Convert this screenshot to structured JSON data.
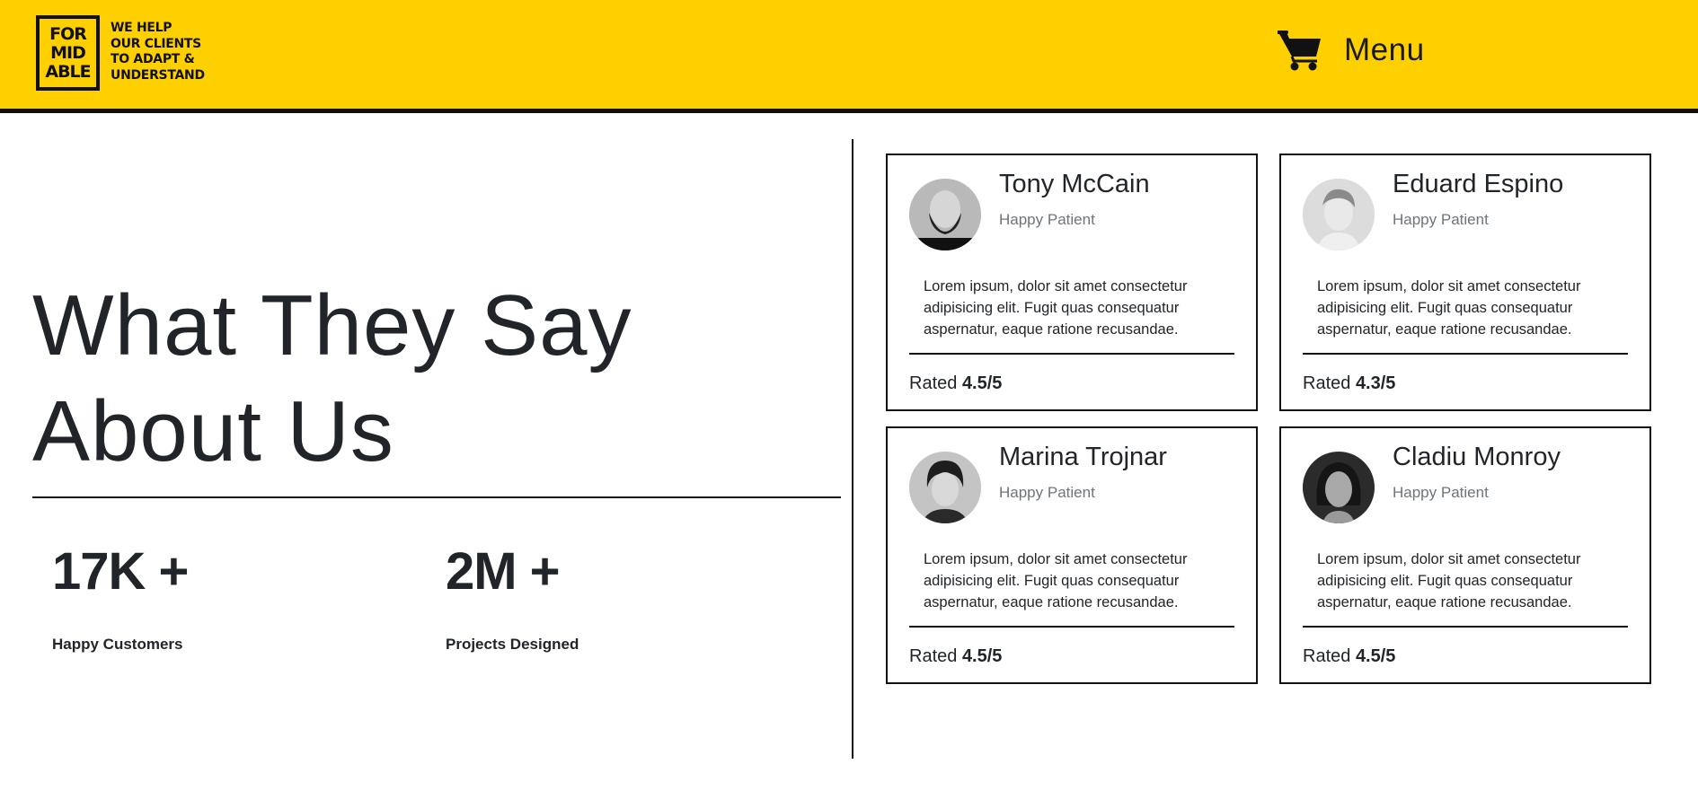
{
  "header": {
    "logo_lines": [
      "FOR",
      "MID",
      "ABLE"
    ],
    "tagline": [
      "WE HELP",
      "OUR CLIENTS",
      "TO ADAPT &",
      "UNDERSTAND"
    ],
    "cart_icon": "shopping-cart-icon",
    "menu_label": "Menu",
    "background_color": "#ffd000"
  },
  "main": {
    "heading_line1": "What They Say",
    "heading_line2": "About Us",
    "stats": [
      {
        "value": "17K +",
        "label": "Happy Customers"
      },
      {
        "value": "2M +",
        "label": "Projects Designed"
      }
    ]
  },
  "testimonials": [
    {
      "name": "Tony McCain",
      "role": "Happy Patient",
      "text": "Lorem ipsum, dolor sit amet consectetur adipisicing elit. Fugit quas consequatur aspernatur, eaque ratione recusandae.",
      "rating_prefix": "Rated",
      "rating": "4.5/5"
    },
    {
      "name": "Eduard Espino",
      "role": "Happy Patient",
      "text": "Lorem ipsum, dolor sit amet consectetur adipisicing elit. Fugit quas consequatur aspernatur, eaque ratione recusandae.",
      "rating_prefix": "Rated",
      "rating": "4.3/5"
    },
    {
      "name": "Marina Trojnar",
      "role": "Happy Patient",
      "text": "Lorem ipsum, dolor sit amet consectetur adipisicing elit. Fugit quas consequatur aspernatur, eaque ratione recusandae.",
      "rating_prefix": "Rated",
      "rating": "4.5/5"
    },
    {
      "name": "Cladiu Monroy",
      "role": "Happy Patient",
      "text": "Lorem ipsum, dolor sit amet consectetur adipisicing elit. Fugit quas consequatur aspernatur, eaque ratione recusandae.",
      "rating_prefix": "Rated",
      "rating": "4.5/5"
    }
  ]
}
